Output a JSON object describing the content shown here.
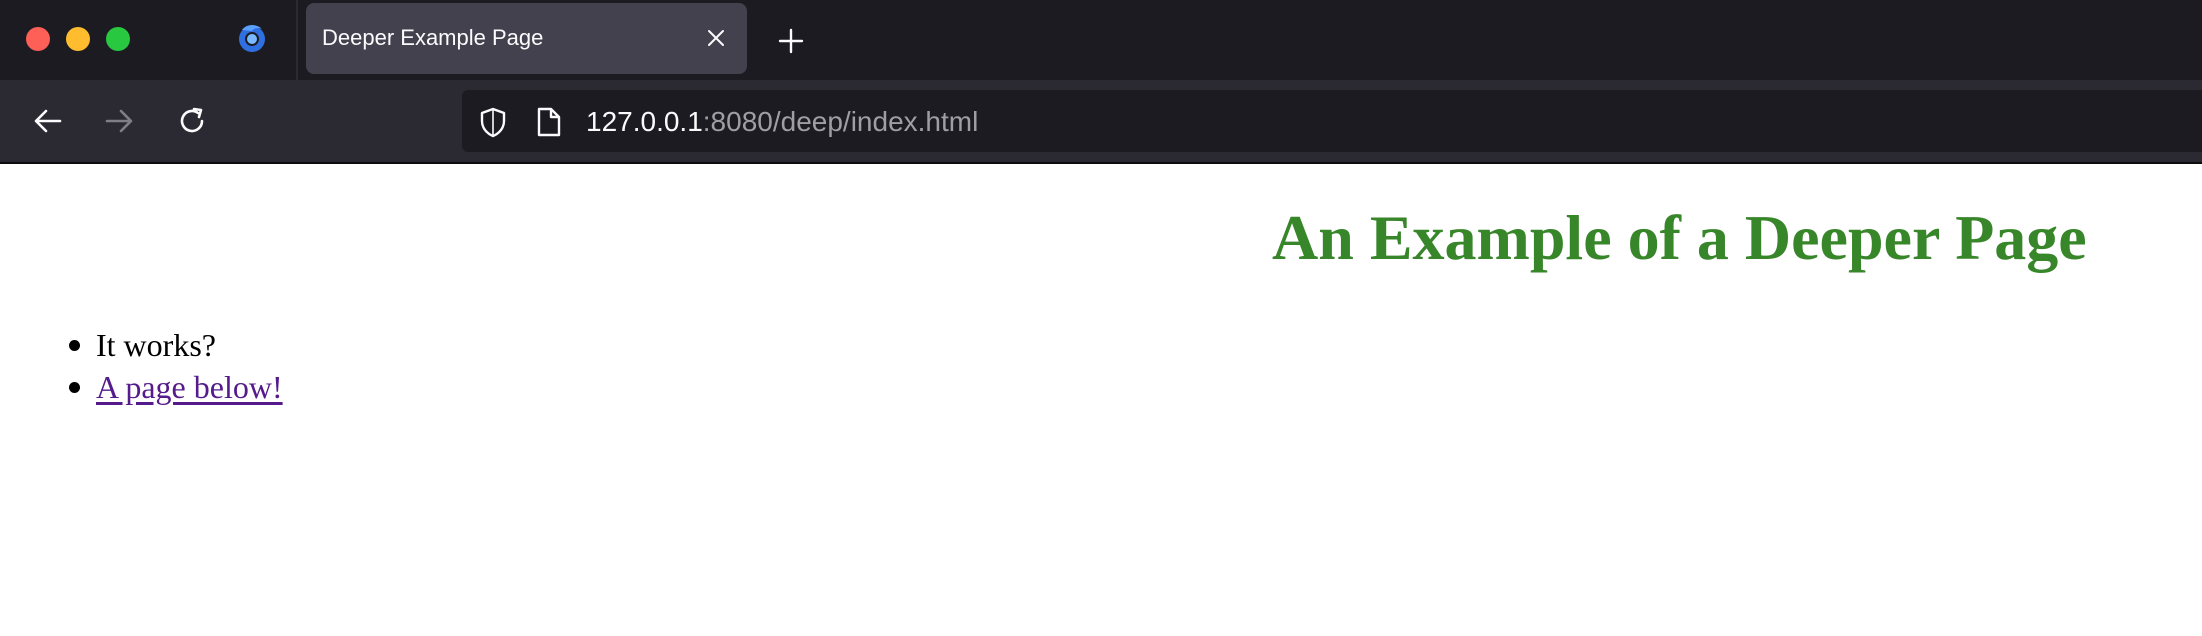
{
  "browser": {
    "tab": {
      "title": "Deeper Example Page"
    },
    "address_bar": {
      "host": "127.0.0.1",
      "rest": ":8080/deep/index.html"
    },
    "icons": {
      "close": "close-icon",
      "minimize": "minimize-icon",
      "maximize": "maximize-icon",
      "browser_logo": "firefox-logo-icon",
      "tab_close": "close-icon",
      "new_tab": "plus-icon",
      "back": "arrow-left-icon",
      "forward": "arrow-right-icon",
      "reload": "reload-icon",
      "site_info": "shield-icon",
      "page": "page-icon"
    },
    "colors": {
      "traffic_red": "#fe5f57",
      "traffic_yellow": "#febc2e",
      "traffic_green": "#28c840"
    }
  },
  "page": {
    "heading": "An Example of a Deeper Page",
    "heading_color": "#38862a",
    "list": [
      {
        "text": "It works?",
        "is_link": false
      },
      {
        "text": "A page below!",
        "is_link": true
      }
    ],
    "link_color": "#551a8b"
  }
}
